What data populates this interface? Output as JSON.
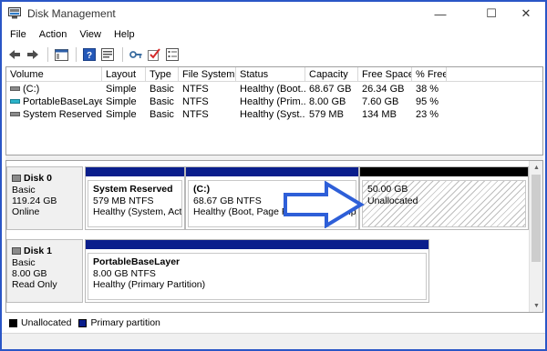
{
  "window": {
    "title": "Disk Management",
    "min_glyph": "—",
    "max_glyph": "☐",
    "close_glyph": "✕"
  },
  "menu": [
    "File",
    "Action",
    "View",
    "Help"
  ],
  "toolbar": {
    "icons": [
      "back-arrow-icon",
      "forward-arrow-icon",
      "console-tree-icon",
      "help-icon",
      "properties-icon",
      "key-icon",
      "check-icon",
      "list-icon"
    ]
  },
  "volumes": {
    "columns": [
      "Volume",
      "Layout",
      "Type",
      "File System",
      "Status",
      "Capacity",
      "Free Space",
      "% Free"
    ],
    "rows": [
      {
        "volume": "(C:)",
        "layout": "Simple",
        "type": "Basic",
        "fs": "NTFS",
        "status": "Healthy (Boot...",
        "capacity": "68.67 GB",
        "free": "26.34 GB",
        "pct": "38 %",
        "icon": "drive"
      },
      {
        "volume": "PortableBaseLayer",
        "layout": "Simple",
        "type": "Basic",
        "fs": "NTFS",
        "status": "Healthy (Prim...",
        "capacity": "8.00 GB",
        "free": "7.60 GB",
        "pct": "95 %",
        "icon": "usb"
      },
      {
        "volume": "System Reserved",
        "layout": "Simple",
        "type": "Basic",
        "fs": "NTFS",
        "status": "Healthy (Syst...",
        "capacity": "579 MB",
        "free": "134 MB",
        "pct": "23 %",
        "icon": "drive"
      }
    ]
  },
  "disks": [
    {
      "name": "Disk 0",
      "type": "Basic",
      "size": "119.24 GB",
      "state": "Online",
      "partitions": [
        {
          "title": "System Reserved",
          "size_fs": "579 MB NTFS",
          "status": "Healthy (System, Activ",
          "bar_color": "#0a1e8c"
        },
        {
          "title": "(C:)",
          "size_fs": "68.67 GB NTFS",
          "status": "Healthy (Boot, Page File, Crash Dump, Pr",
          "bar_color": "#0a1e8c"
        },
        {
          "title": "",
          "size_fs": "50.00 GB",
          "status": "Unallocated",
          "bar_color": "#000000"
        }
      ]
    },
    {
      "name": "Disk 1",
      "type": "Basic",
      "size": "8.00 GB",
      "state": "Read Only",
      "partitions": [
        {
          "title": "PortableBaseLayer",
          "size_fs": "8.00 GB NTFS",
          "status": "Healthy (Primary Partition)",
          "bar_color": "#0a1e8c"
        }
      ]
    }
  ],
  "legend": [
    {
      "label": "Unallocated",
      "color": "#000000"
    },
    {
      "label": "Primary partition",
      "color": "#0a1e8c"
    }
  ],
  "colors": {
    "primary": "#0a1e8c",
    "unallocated": "#000000",
    "window_border": "#2a56c6",
    "annotation_arrow": "#2e5fd8"
  }
}
